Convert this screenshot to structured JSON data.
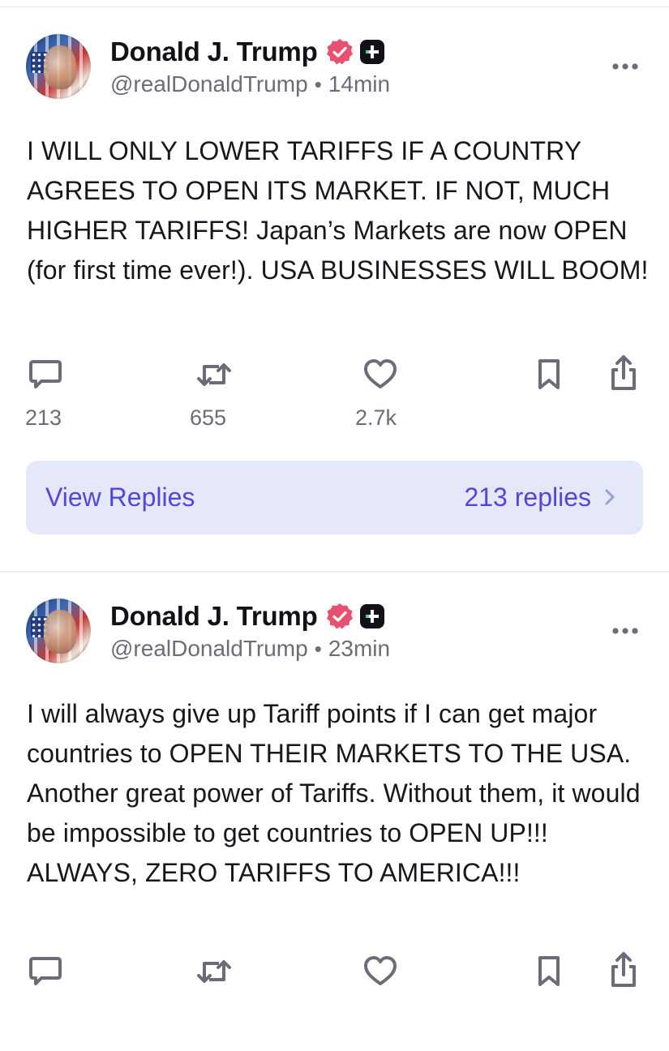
{
  "posts": [
    {
      "author": "Donald J. Trump",
      "handle": "@realDonaldTrump",
      "separator": "•",
      "time": "14min",
      "text": "I WILL ONLY LOWER TARIFFS IF A COUNTRY AGREES TO OPEN ITS MARKET. IF NOT, MUCH HIGHER TARIFFS! Japan’s Markets are now OPEN (for first time ever!). USA BUSINESSES WILL BOOM!",
      "counts": {
        "replies": "213",
        "reposts": "655",
        "likes": "2.7k"
      },
      "view_replies_label": "View Replies",
      "replies_count_label": "213 replies"
    },
    {
      "author": "Donald J. Trump",
      "handle": "@realDonaldTrump",
      "separator": "•",
      "time": "23min",
      "text": "I will always give up Tariff points if I can get major countries to OPEN THEIR MARKETS TO THE USA. Another great power of Tariffs. Without them, it would be impossible to get countries to OPEN UP!!! ALWAYS, ZERO TARIFFS TO AMERICA!!!"
    }
  ],
  "icons": {
    "verified": "verified-badge-icon",
    "plus": "plus-badge-icon",
    "more": "more-horizontal-icon",
    "reply": "comment-icon",
    "repost": "repost-icon",
    "like": "heart-icon",
    "bookmark": "bookmark-icon",
    "share": "share-icon",
    "chevron": "chevron-right-icon"
  },
  "colors": {
    "accent": "#5546d8",
    "verified": "#e7506f",
    "replies_bar_bg": "#e5e8f8",
    "muted_text": "#6c6c78"
  }
}
